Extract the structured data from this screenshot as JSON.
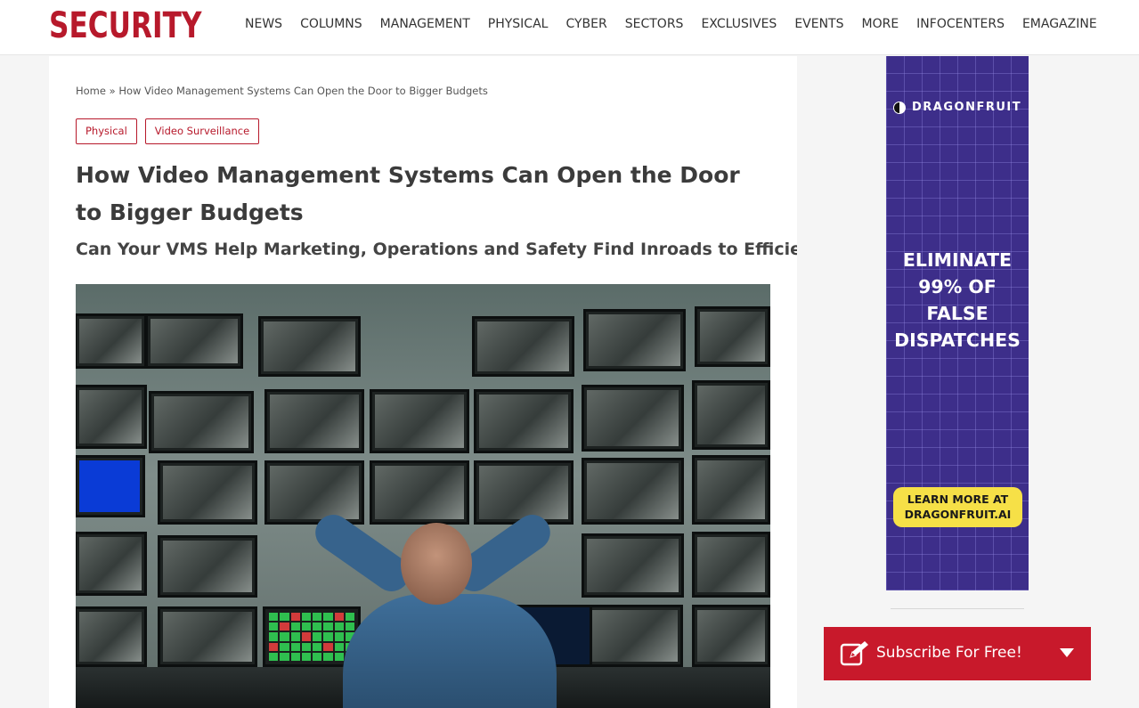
{
  "header": {
    "logo": "SECURITY",
    "nav": [
      "NEWS",
      "COLUMNS",
      "MANAGEMENT",
      "PHYSICAL",
      "CYBER",
      "SECTORS",
      "EXCLUSIVES",
      "EVENTS",
      "MORE",
      "INFOCENTERS",
      "EMAGAZINE"
    ]
  },
  "article": {
    "breadcrumb": {
      "home": "Home",
      "separator": " » ",
      "current": "How Video Management Systems Can Open the Door to Bigger Budgets"
    },
    "tags": [
      "Physical",
      "Video Surveillance"
    ],
    "title": "How Video Management Systems Can Open the Door to Bigger Budgets",
    "subtitle": "Can Your VMS Help Marketing, Operations and Safety Find Inroads to Efficiency?"
  },
  "sidebar": {
    "ad": {
      "brand": "DRAGONFRUIT",
      "headline": "ELIMINATE\n99% OF\nFALSE\nDISPATCHES",
      "cta": "LEARN MORE AT\nDRAGONFRUIT.AI",
      "accent_color": "#f6e047",
      "background_color": "#3d2e8a"
    },
    "subscribe": {
      "label": "Subscribe For Free!",
      "icon": "pencil-edit-icon",
      "arrow_icon": "caret-down-icon",
      "color": "#c8192b"
    }
  },
  "colors": {
    "brand": "#b7192b"
  }
}
